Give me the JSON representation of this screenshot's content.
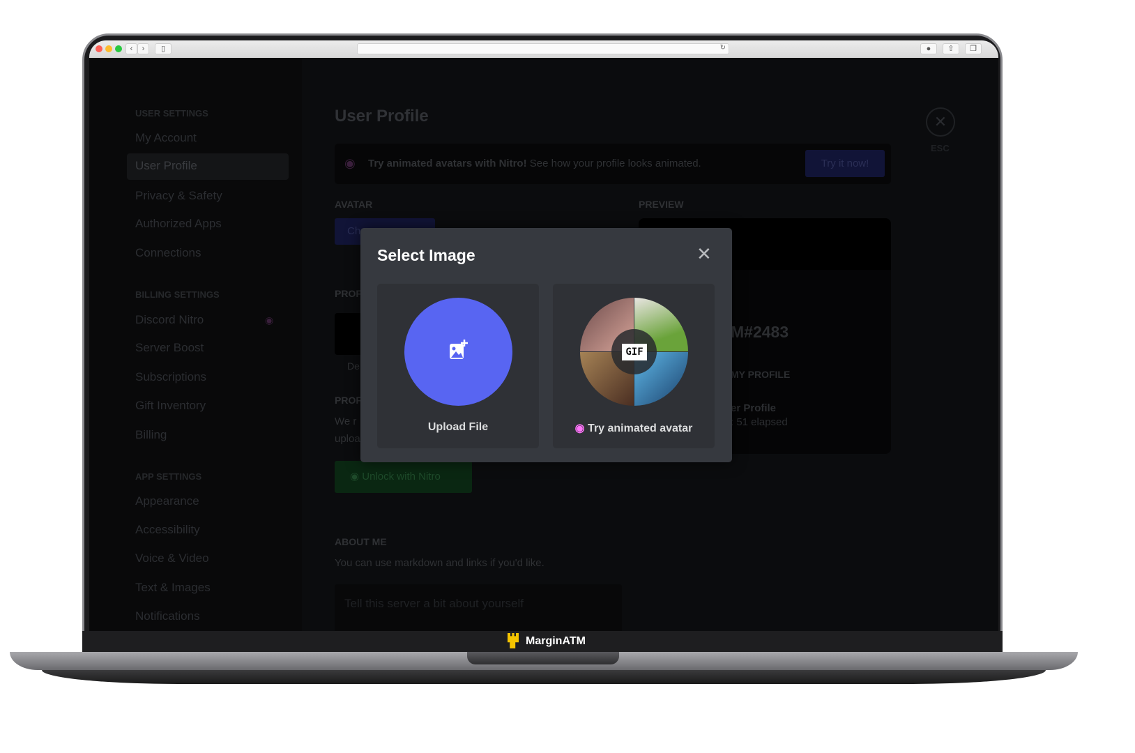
{
  "browser": {
    "back": "‹",
    "forward": "›"
  },
  "sidebar": {
    "sections": [
      {
        "title": "USER SETTINGS",
        "items": [
          "My Account",
          "User Profile",
          "Privacy & Safety",
          "Authorized Apps",
          "Connections"
        ]
      },
      {
        "title": "BILLING SETTINGS",
        "items": [
          "Discord Nitro",
          "Server Boost",
          "Subscriptions",
          "Gift Inventory",
          "Billing"
        ]
      },
      {
        "title": "APP SETTINGS",
        "items": [
          "Appearance",
          "Accessibility",
          "Voice & Video",
          "Text & Images",
          "Notifications"
        ]
      }
    ],
    "selected": "User Profile"
  },
  "main": {
    "title": "User Profile",
    "banner": {
      "bold": "Try animated avatars with Nitro!",
      "text": "See how your profile looks animated.",
      "button": "Try it now!"
    },
    "avatar_label": "AVATAR",
    "avatar_button_fragment": "Ch",
    "preview_label": "PREVIEW",
    "profile_label_fragment": "PROF",
    "profile_label2_fragment": "PROF",
    "default_fragment": "De",
    "profile_text_fragments": [
      "We r",
      "uploa"
    ],
    "unlock_button": "Unlock with Nitro",
    "about_label": "ABOUT ME",
    "about_hint": "You can use markdown and links if you'd like.",
    "about_placeholder": "Tell this server a bit about yourself",
    "preview_tag": "M#2483",
    "preview_section": "MY PROFILE",
    "preview_activity": "er Profile",
    "preview_elapsed": ": 51 elapsed",
    "esc_label": "ESC"
  },
  "modal": {
    "title": "Select Image",
    "upload_label": "Upload File",
    "animated_label": "Try animated avatar",
    "gif_badge": "GIF"
  },
  "taskbar": {
    "brand": "MarginATM"
  },
  "colors": {
    "blurple": "#5865f2",
    "nitro_pink": "#ff73fa",
    "modal_bg": "#36393f",
    "card_bg": "#2f3136",
    "brand_yellow": "#f5c400"
  }
}
